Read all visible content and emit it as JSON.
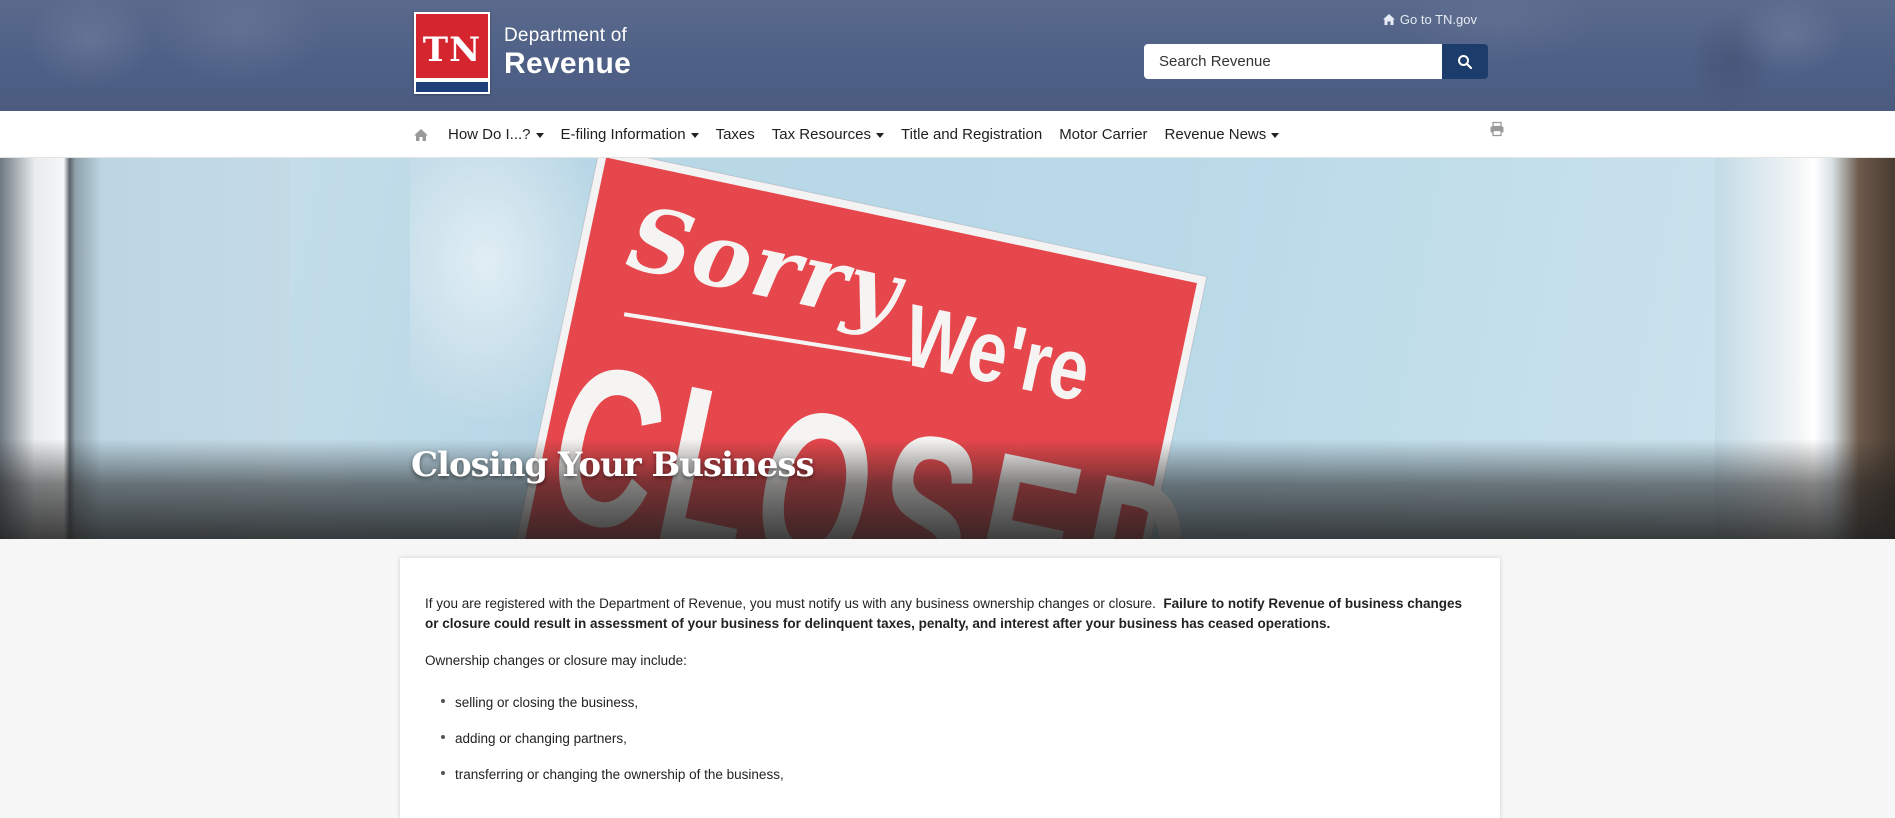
{
  "header": {
    "logo_mark": "TN",
    "logo_line1": "Department of",
    "logo_line2": "Revenue",
    "goto_label": "Go to TN.gov",
    "search_placeholder": "Search Revenue"
  },
  "nav": {
    "items": [
      {
        "label": "How Do I...?",
        "dropdown": true
      },
      {
        "label": "E-filing Information",
        "dropdown": true
      },
      {
        "label": "Taxes",
        "dropdown": false
      },
      {
        "label": "Tax Resources",
        "dropdown": true
      },
      {
        "label": "Title and Registration",
        "dropdown": false
      },
      {
        "label": "Motor Carrier",
        "dropdown": false
      },
      {
        "label": "Revenue News",
        "dropdown": true
      }
    ]
  },
  "hero": {
    "title": "Closing Your Business",
    "sign_line1": "Sorry",
    "sign_line2": "We're",
    "sign_line3": "CLOSED"
  },
  "content": {
    "intro_plain": "If you are registered with the Department of Revenue, you must notify us with any business ownership changes or closure.",
    "intro_bold": "Failure to notify Revenue of business changes or closure could result in assessment of your business for delinquent taxes, penalty, and interest after your business has ceased operations.",
    "lead": "Ownership changes or closure may include:",
    "bullets": [
      "selling or closing the business,",
      "adding or changing partners,",
      "transferring or changing the ownership of the business,"
    ]
  },
  "colors": {
    "banner": "#4f6087",
    "logo_red": "#d5252e",
    "search_button": "#1c3c6b",
    "sign_red": "#e6474c"
  }
}
